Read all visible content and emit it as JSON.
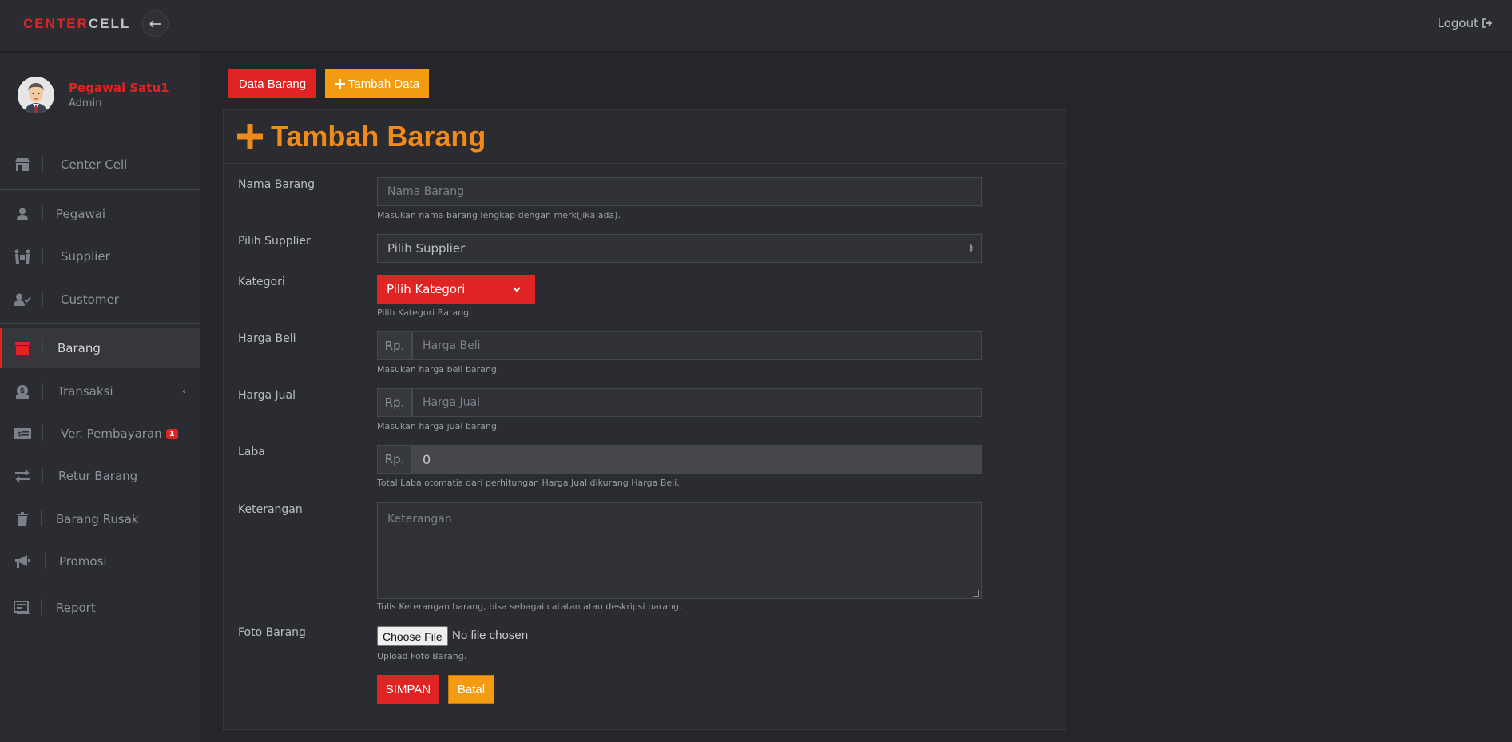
{
  "header": {
    "brand_part1": "CENTER",
    "brand_part2": "CELL",
    "logout_label": "Logout"
  },
  "profile": {
    "name": "Pegawai Satu1",
    "role": "Admin"
  },
  "sidebar": {
    "items": [
      {
        "label": "Center Cell",
        "icon": "store-icon"
      },
      {
        "label": "Pegawai",
        "icon": "user-icon"
      },
      {
        "label": "Supplier",
        "icon": "people-carry-icon"
      },
      {
        "label": "Customer",
        "icon": "user-check-icon"
      },
      {
        "label": "Barang",
        "icon": "archive-icon",
        "active": true
      },
      {
        "label": "Transaksi",
        "icon": "money-bag-icon",
        "chevron": "‹"
      },
      {
        "label": "Ver. Pembayaran",
        "icon": "money-check-icon",
        "badge": "1"
      },
      {
        "label": "Retur Barang",
        "icon": "exchange-icon"
      },
      {
        "label": "Barang Rusak",
        "icon": "trash-icon"
      },
      {
        "label": "Promosi",
        "icon": "bullhorn-icon"
      },
      {
        "label": "Report",
        "icon": "report-icon"
      }
    ]
  },
  "toolbar": {
    "data_barang_label": "Data Barang",
    "tambah_data_label": "Tambah Data"
  },
  "form": {
    "title": "Tambah Barang",
    "nama_barang": {
      "label": "Nama Barang",
      "placeholder": "Nama Barang",
      "help": "Masukan nama barang lengkap dengan merk(jika ada)."
    },
    "supplier": {
      "label": "Pilih Supplier",
      "selected": "Pilih Supplier"
    },
    "kategori": {
      "label": "Kategori",
      "button": "Pilih Kategori",
      "help": "Pilih Kategori Barang."
    },
    "harga_beli": {
      "label": "Harga Beli",
      "prefix": "Rp.",
      "placeholder": "Harga Beli",
      "help": "Masukan harga beli barang."
    },
    "harga_jual": {
      "label": "Harga Jual",
      "prefix": "Rp.",
      "placeholder": "Harga Jual",
      "help": "Masukan harga jual barang."
    },
    "laba": {
      "label": "Laba",
      "prefix": "Rp.",
      "value": "0",
      "help": "Total Laba otomatis dari perhitungan Harga Jual dikurang Harga Beli."
    },
    "keterangan": {
      "label": "Keterangan",
      "placeholder": "Keterangan",
      "help": "Tulis Keterangan barang, bisa sebagai catatan atau deskripsi barang."
    },
    "foto": {
      "label": "Foto Barang",
      "button": "Choose File",
      "status": "No file chosen",
      "help": "Upload Foto Barang."
    },
    "simpan_label": "SIMPAN",
    "batal_label": "Batal"
  },
  "colors": {
    "accent_red": "#e02424",
    "accent_orange": "#f39c12",
    "title_orange": "#f08a1a",
    "background": "#24262b"
  }
}
